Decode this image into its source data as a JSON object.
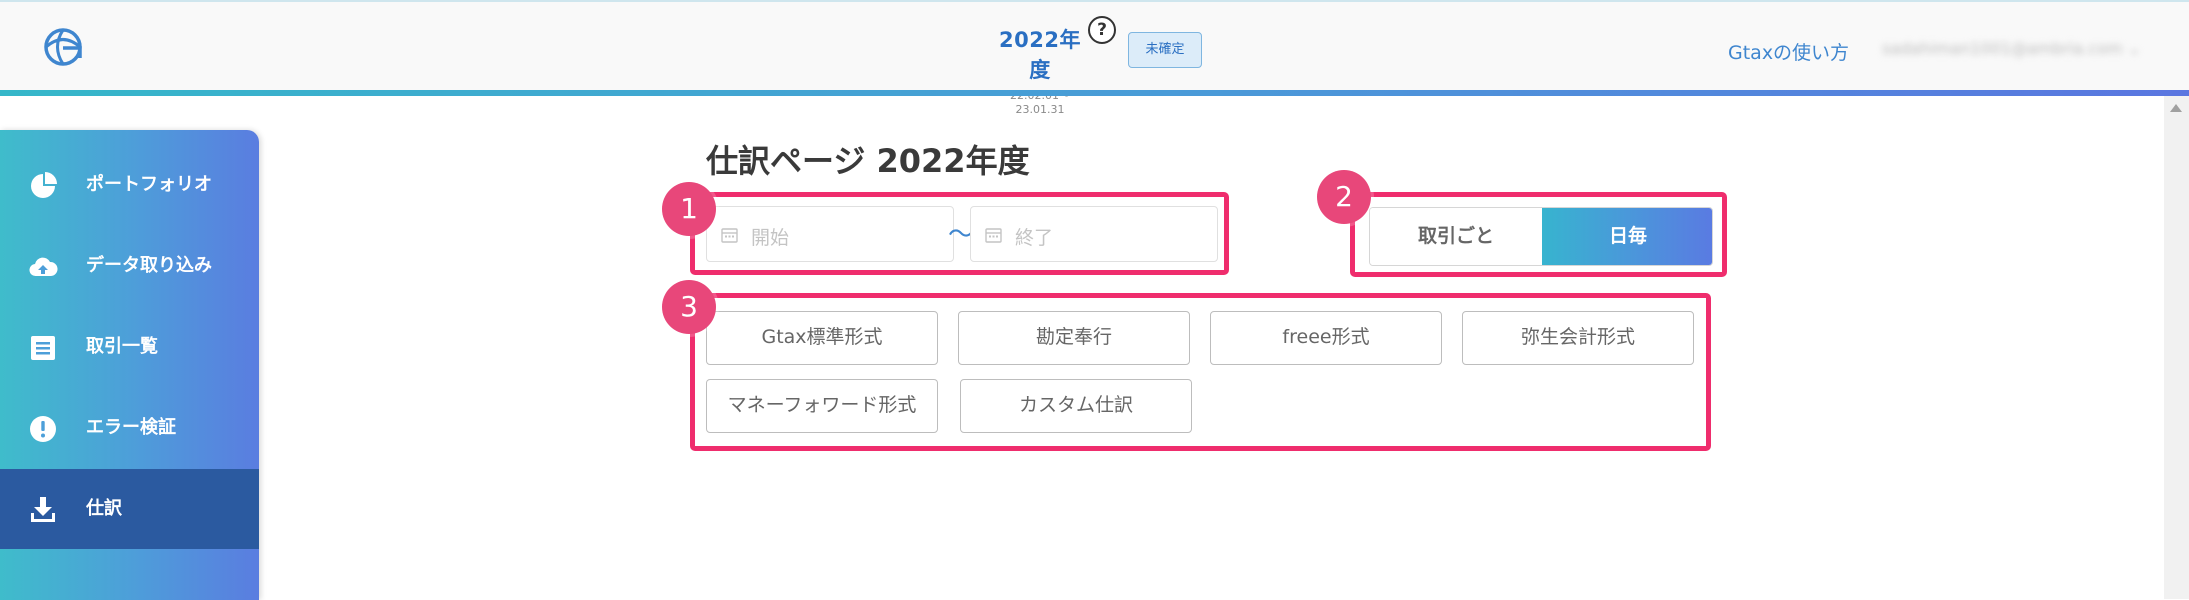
{
  "header": {
    "fiscal_year": "2022年度",
    "fiscal_range": "22.02.01〜23.01.31",
    "help_icon": "question-circle-icon",
    "status_badge": "未確定",
    "help_link": "Gtaxの使い方",
    "account": "sadahiman1001@ambria.com",
    "account_chevron": "⌄"
  },
  "sidebar": {
    "items": [
      {
        "label": "ポートフォリオ",
        "icon": "pie-chart-icon",
        "active": false
      },
      {
        "label": "データ取り込み",
        "icon": "cloud-upload-icon",
        "active": false
      },
      {
        "label": "取引一覧",
        "icon": "list-document-icon",
        "active": false
      },
      {
        "label": "エラー検証",
        "icon": "alert-circle-icon",
        "active": false
      },
      {
        "label": "仕訳",
        "icon": "download-icon",
        "active": true
      }
    ]
  },
  "main": {
    "title": "仕訳ページ 2022年度",
    "date_range": {
      "start_placeholder": "開始",
      "end_placeholder": "終了",
      "separator": "〜",
      "icon": "calendar-icon"
    },
    "grouping": {
      "options": [
        "取引ごと",
        "日毎"
      ],
      "selected": "日毎"
    },
    "formats": [
      "Gtax標準形式",
      "勘定奉行",
      "freee形式",
      "弥生会計形式",
      "マネーフォワード形式",
      "カスタム仕訳"
    ]
  },
  "callouts": [
    "1",
    "2",
    "3"
  ],
  "colors": {
    "accent": "#2a6fc2",
    "callout": "#ef2d6d",
    "sidebar_active": "#2b5aa0",
    "gradient_start": "#3fbccb",
    "gradient_end": "#5a7de0"
  }
}
